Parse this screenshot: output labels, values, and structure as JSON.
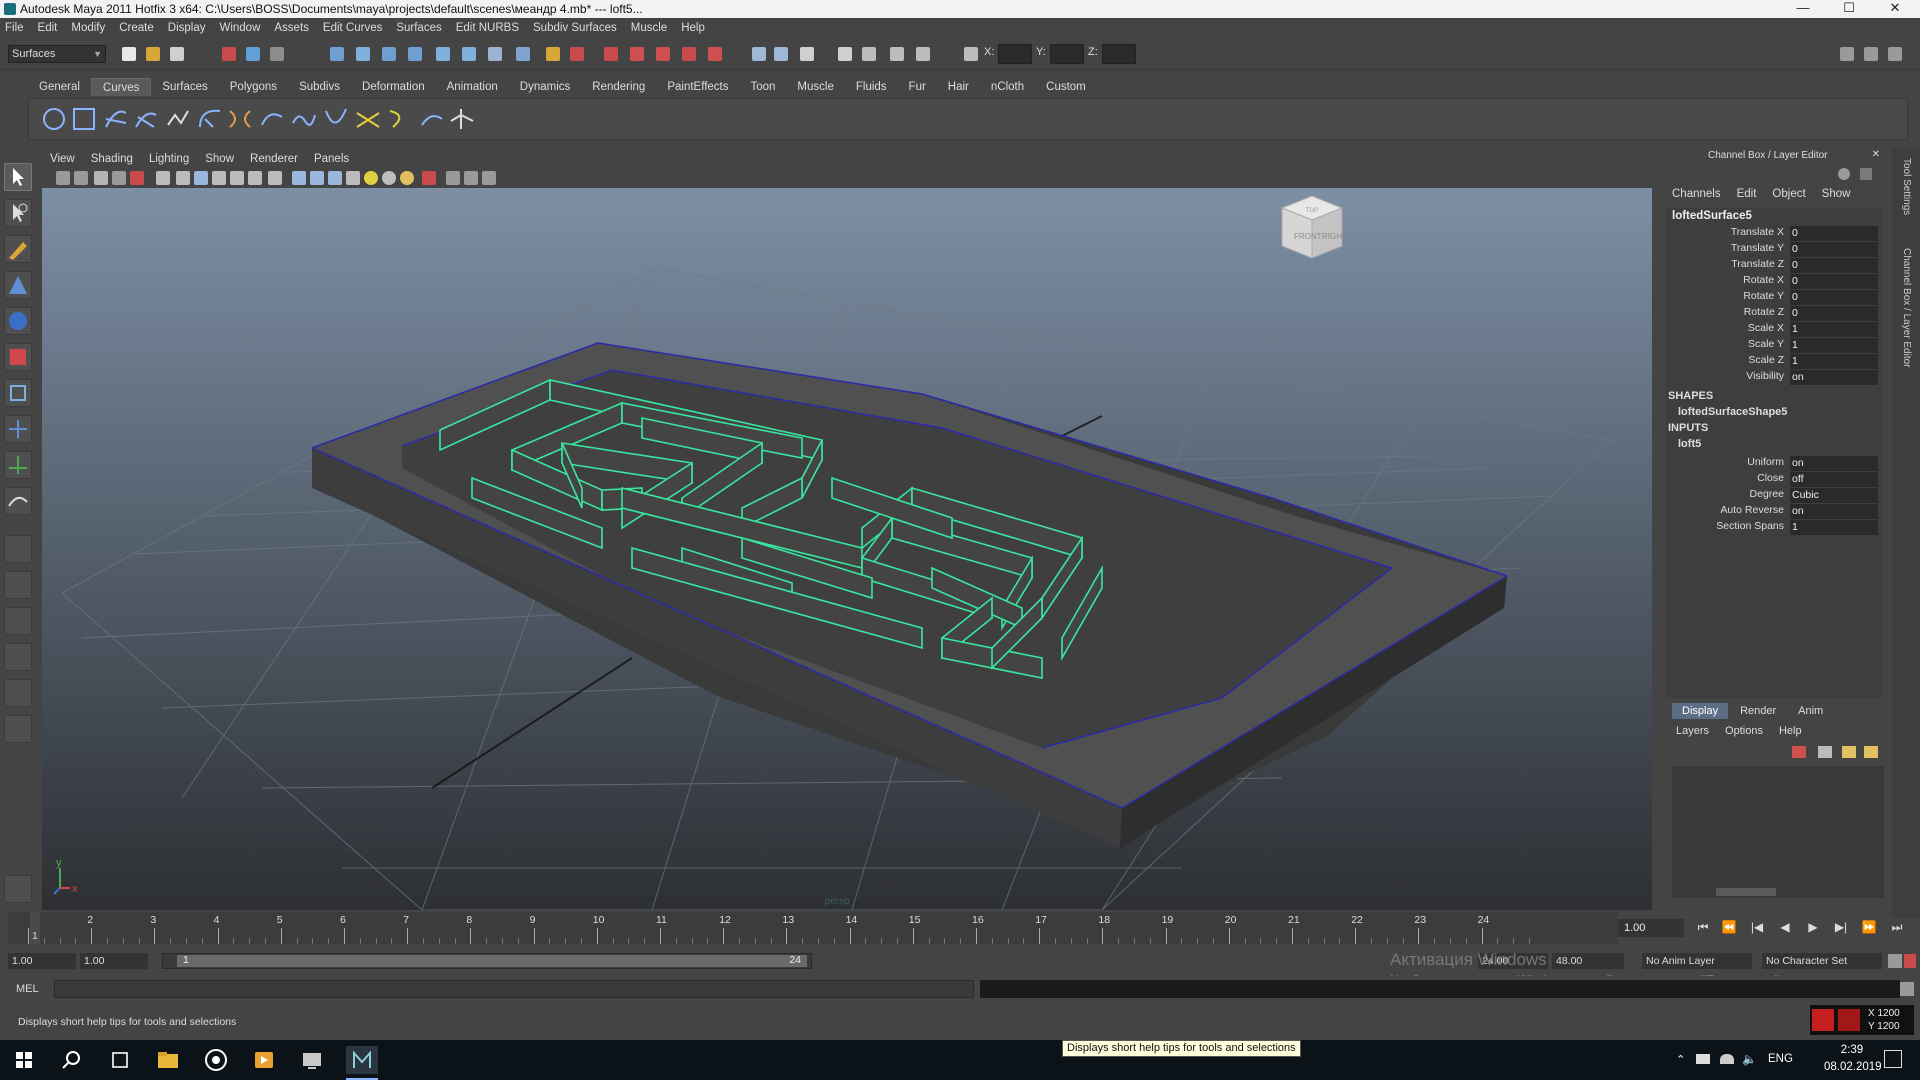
{
  "window": {
    "title": "Autodesk Maya 2011 Hotfix 3 x64: C:\\Users\\BOSS\\Documents\\maya\\projects\\default\\scenes\\меандр 4.mb*   ---   loft5...",
    "minimize": "—",
    "maximize": "☐",
    "close": "✕"
  },
  "menubar": [
    "File",
    "Edit",
    "Modify",
    "Create",
    "Display",
    "Window",
    "Assets",
    "Edit Curves",
    "Surfaces",
    "Edit NURBS",
    "Subdiv Surfaces",
    "Muscle",
    "Help"
  ],
  "statusline": {
    "mode": "Surfaces",
    "x_label": "X:",
    "y_label": "Y:",
    "z_label": "Z:"
  },
  "shelf": {
    "tabs": [
      "General",
      "Curves",
      "Surfaces",
      "Polygons",
      "Subdivs",
      "Deformation",
      "Animation",
      "Dynamics",
      "Rendering",
      "PaintEffects",
      "Toon",
      "Muscle",
      "Fluids",
      "Fur",
      "Hair",
      "nCloth",
      "Custom"
    ],
    "active_tab": "Curves"
  },
  "viewport": {
    "menu": [
      "View",
      "Shading",
      "Lighting",
      "Show",
      "Renderer",
      "Panels"
    ],
    "viewcube_front": "FRONT",
    "viewcube_right": "RIGHT",
    "viewcube_top": "TOP",
    "axis_y": "y",
    "axis_x": "x",
    "camera_label": "persp"
  },
  "channel_box": {
    "header": "Channel Box / Layer Editor",
    "menu": [
      "Channels",
      "Edit",
      "Object",
      "Show"
    ],
    "object_name": "loftedSurface5",
    "attributes": [
      {
        "label": "Translate X",
        "value": "0"
      },
      {
        "label": "Translate Y",
        "value": "0"
      },
      {
        "label": "Translate Z",
        "value": "0"
      },
      {
        "label": "Rotate X",
        "value": "0"
      },
      {
        "label": "Rotate Y",
        "value": "0"
      },
      {
        "label": "Rotate Z",
        "value": "0"
      },
      {
        "label": "Scale X",
        "value": "1"
      },
      {
        "label": "Scale Y",
        "value": "1"
      },
      {
        "label": "Scale Z",
        "value": "1"
      },
      {
        "label": "Visibility",
        "value": "on"
      }
    ],
    "shapes_header": "SHAPES",
    "shape_name": "loftedSurfaceShape5",
    "inputs_header": "INPUTS",
    "input_name": "loft5",
    "input_attributes": [
      {
        "label": "Uniform",
        "value": "on"
      },
      {
        "label": "Close",
        "value": "off"
      },
      {
        "label": "Degree",
        "value": "Cubic"
      },
      {
        "label": "Auto Reverse",
        "value": "on"
      },
      {
        "label": "Section Spans",
        "value": "1"
      }
    ]
  },
  "side_tabs": {
    "tool_settings": "Tool Settings",
    "channel_box": "Channel Box / Layer Editor"
  },
  "layer_editor": {
    "tabs": [
      "Display",
      "Render",
      "Anim"
    ],
    "active_tab": "Display",
    "menu": [
      "Layers",
      "Options",
      "Help"
    ]
  },
  "time_slider": {
    "frames": [
      "1",
      "2",
      "3",
      "4",
      "5",
      "6",
      "7",
      "8",
      "9",
      "10",
      "11",
      "12",
      "13",
      "14",
      "15",
      "16",
      "17",
      "18",
      "19",
      "20",
      "21",
      "22",
      "23",
      "24"
    ],
    "current_frame": "1",
    "current_field": "1.00",
    "playback": [
      "⏮",
      "⏪",
      "|◀",
      "◀",
      "▶",
      "▶|",
      "⏩",
      "⏭"
    ]
  },
  "range_bar": {
    "start_time": "1.00",
    "playback_start": "1.00",
    "range_start": "1",
    "range_end": "24",
    "playback_end": "24.00",
    "end_time": "48.00",
    "anim_layer": "No Anim Layer",
    "character_set": "No Character Set",
    "activation_title": "Активация Windows",
    "activation_text": "Чтобы активировать Windows, перейдите в раздел \"Параметры\"."
  },
  "command_line": {
    "label": "MEL"
  },
  "help_line": {
    "text": "Displays short help tips for tools and selections"
  },
  "coord_readout": {
    "x": "X 1200",
    "y": "Y 1200"
  },
  "taskbar": {
    "tooltip": "Displays short help tips for tools and selections",
    "language": "ENG",
    "time": "2:39",
    "date": "08.02.2019"
  },
  "colors": {
    "wire": "#38e6a0",
    "boundary": "#2a2aa8",
    "background_top": "#7d8fa5",
    "background_bottom": "#2d2f33",
    "active_tab": "#5b6d85"
  }
}
